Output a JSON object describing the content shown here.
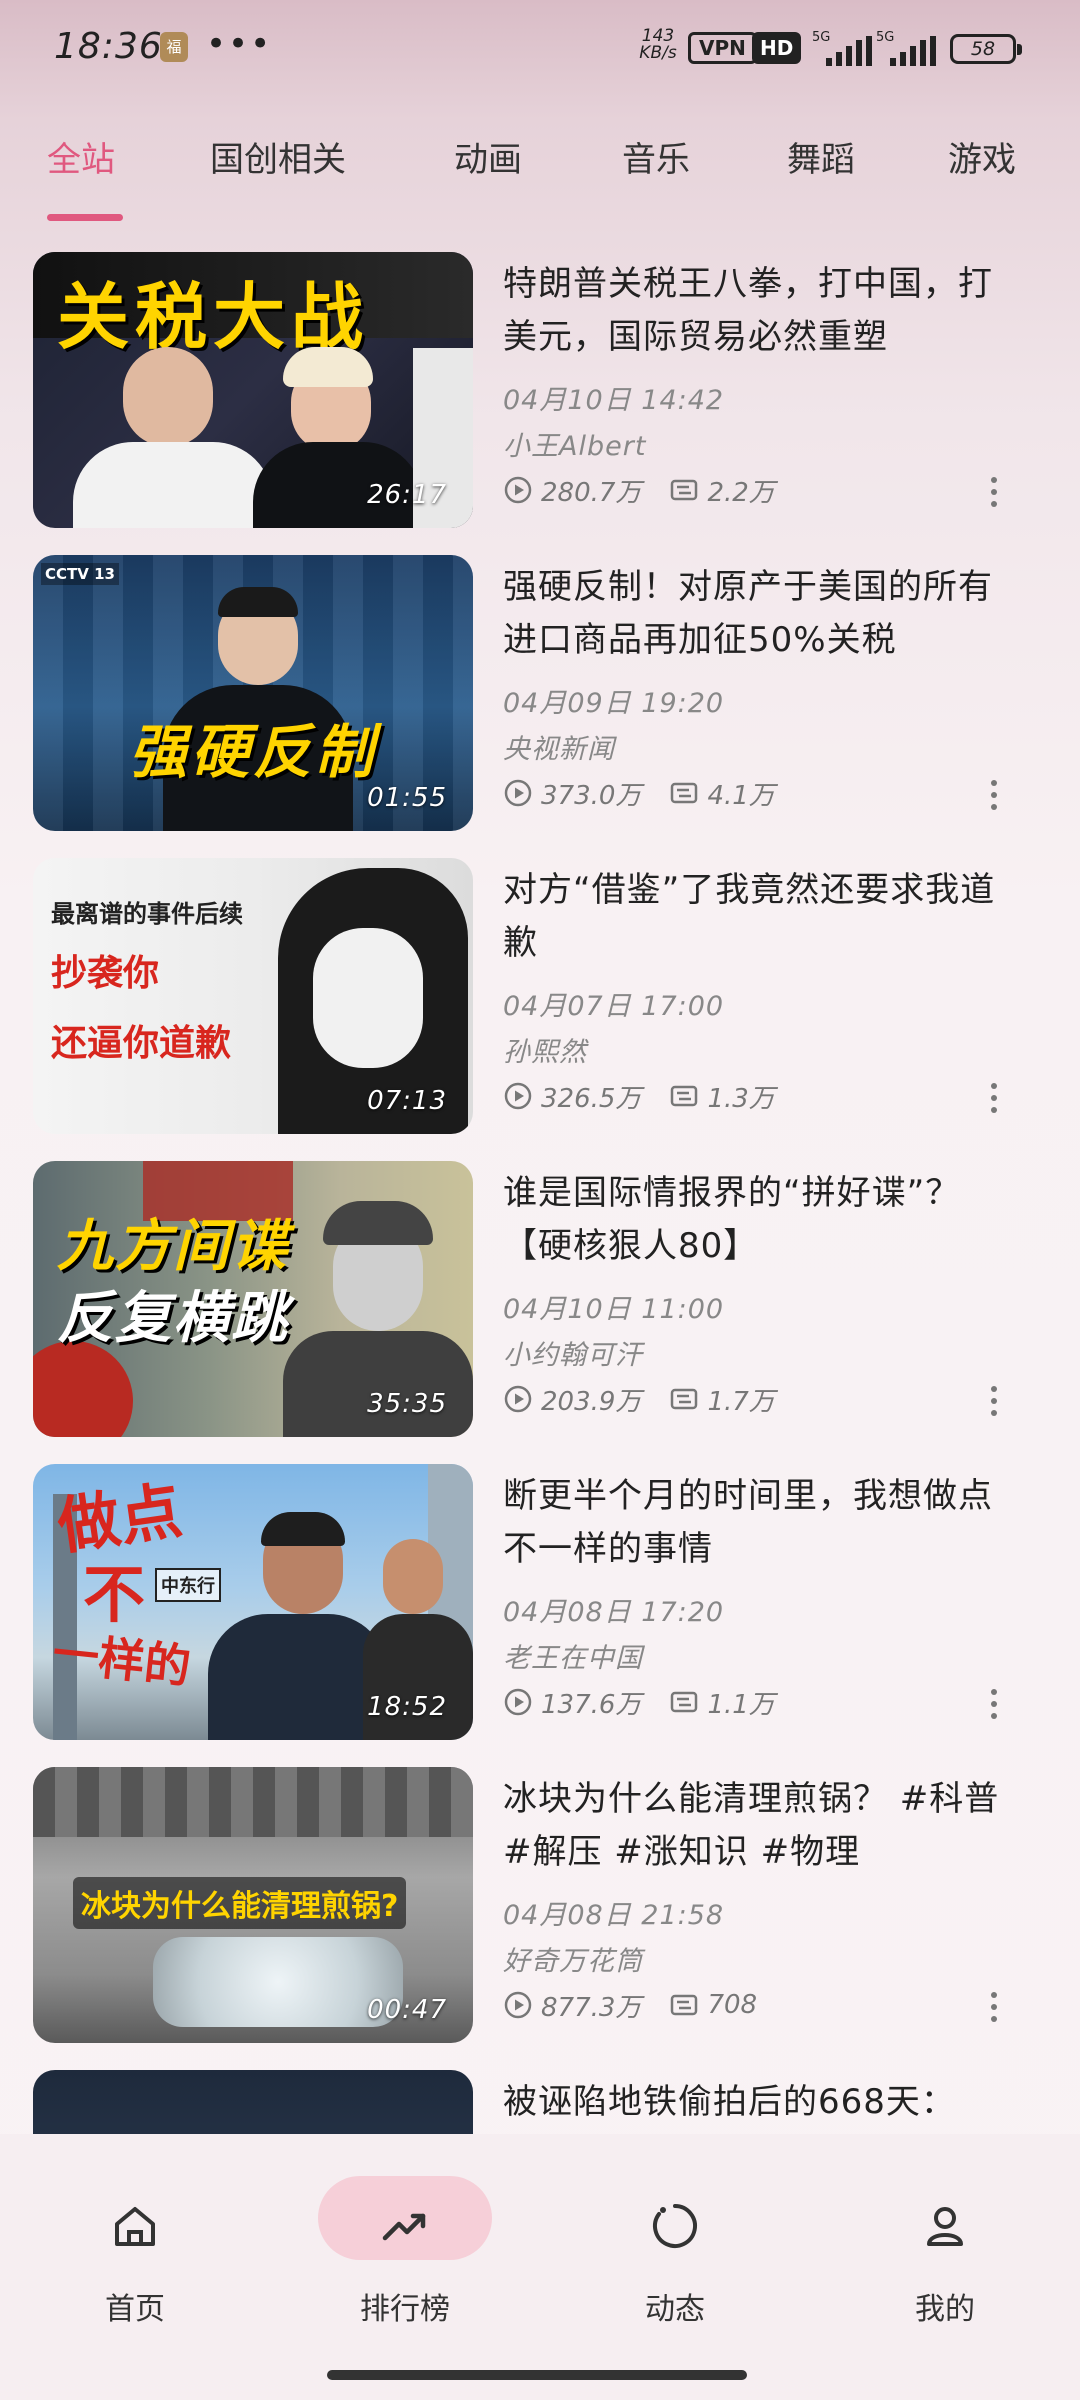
{
  "status_bar": {
    "time": "18:36",
    "notification_badge": "福",
    "more_dots": "•••",
    "net_speed_value": "143",
    "net_speed_unit": "KB/s",
    "vpn": "VPN",
    "hd": "HD",
    "sim1_label": "5G",
    "sim2_label": "5G",
    "battery": "58"
  },
  "tabs": [
    {
      "label": "全站",
      "active": true
    },
    {
      "label": "国创相关",
      "active": false
    },
    {
      "label": "动画",
      "active": false
    },
    {
      "label": "音乐",
      "active": false
    },
    {
      "label": "舞蹈",
      "active": false
    },
    {
      "label": "游戏",
      "active": false
    }
  ],
  "videos": [
    {
      "thumb_text": [
        "关税大战"
      ],
      "duration": "26:17",
      "title": "特朗普关税王八拳，打中国，打美元，国际贸易必然重塑",
      "date": "04月10日 14:42",
      "author": "小王Albert",
      "views": "280.7万",
      "danmaku": "2.2万"
    },
    {
      "thumb_text": [
        "CCTV 13",
        "强硬反制"
      ],
      "duration": "01:55",
      "title": "强硬反制！对原产于美国的所有进口商品再加征50%关税",
      "date": "04月09日 19:20",
      "author": "央视新闻",
      "views": "373.0万",
      "danmaku": "4.1万"
    },
    {
      "thumb_text": [
        "最离谱的事件后续",
        "抄袭你",
        "还逼你道歉"
      ],
      "duration": "07:13",
      "title": "对方“借鉴”了我竟然还要求我道歉",
      "date": "04月07日 17:00",
      "author": "孙熙然",
      "views": "326.5万",
      "danmaku": "1.3万"
    },
    {
      "thumb_text": [
        "九方间谍",
        "反复横跳"
      ],
      "duration": "35:35",
      "title": "谁是国际情报界的“拼好谍”？【硬核狠人80】",
      "date": "04月10日 11:00",
      "author": "小约翰可汗",
      "views": "203.9万",
      "danmaku": "1.7万"
    },
    {
      "thumb_text": [
        "做点",
        "不",
        "一样的",
        "中东行"
      ],
      "duration": "18:52",
      "title": "断更半个月的时间里，我想做点不一样的事情",
      "date": "04月08日 17:20",
      "author": "老王在中国",
      "views": "137.6万",
      "danmaku": "1.1万"
    },
    {
      "thumb_text": [
        "冰块为什么能清理煎锅?"
      ],
      "duration": "00:47",
      "title": "冰块为什么能清理煎锅？ #科普 #解压 #涨知识 #物理",
      "date": "04月08日 21:58",
      "author": "好奇万花筒",
      "views": "877.3万",
      "danmaku": "708"
    },
    {
      "thumb_text": [],
      "duration": "",
      "title": "被诬陷地铁偷拍后的668天：",
      "date": "",
      "author": "",
      "views": "",
      "danmaku": ""
    }
  ],
  "bottom_nav": [
    {
      "label": "首页",
      "icon": "home-icon",
      "active": false
    },
    {
      "label": "排行榜",
      "icon": "trending-icon",
      "active": true
    },
    {
      "label": "动态",
      "icon": "activity-icon",
      "active": false
    },
    {
      "label": "我的",
      "icon": "profile-icon",
      "active": false
    }
  ],
  "colors": {
    "accent": "#e0587f",
    "nav_active_bg": "#f6cfd8",
    "meta_text": "#888888"
  }
}
